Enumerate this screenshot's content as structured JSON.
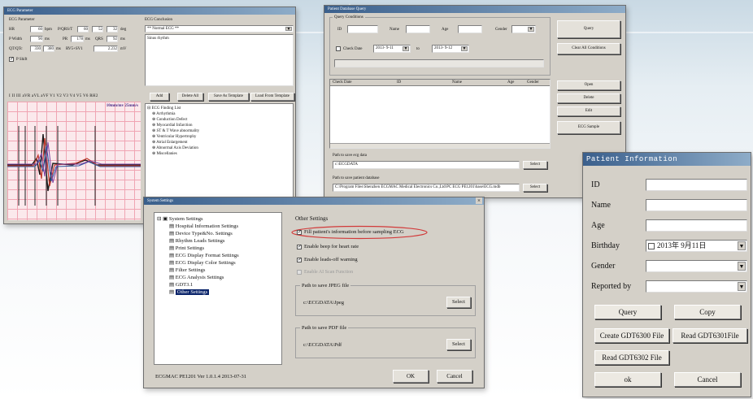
{
  "ecg_params": {
    "title": "ECG Parameter",
    "sections": {
      "parameters": "ECG Parameter",
      "conclusion": "ECG Conclusion"
    },
    "rows": [
      {
        "label": "HR",
        "v1": "60",
        "u1": "bpm",
        "label2": "P/QRS/T",
        "v2": "60",
        "v3": "52",
        "v4": "32",
        "u2": "deg"
      },
      {
        "label": "P Width",
        "v1": "90",
        "u1": "ms",
        "label2": "PR",
        "v2": "178",
        "u2": "ms",
        "label3": "QRS",
        "v3": "92",
        "u3": "ms"
      },
      {
        "label": "QT/QTc",
        "v1": "330",
        "v2": "380",
        "u1": "ms",
        "label2": "RV5+SV1",
        "v3": "2.232",
        "u2": "mV"
      }
    ],
    "pshift": "P Shift",
    "leads": "I  II  III  aVR  aVL  aVF  V1  V2  V3  V4  V5  V6  RH2",
    "speed": "10mm/mv  25mm/s",
    "conclusion_combo": "** Normal ECG **",
    "conclusion_text": "Sinus rhythm",
    "buttons": [
      "Add",
      "Delete All",
      "Save As Template",
      "Load From Template"
    ],
    "finding_root": "ECG Finding List",
    "findings": [
      "Arrhythmia",
      "Conduction Defect",
      "Myocardial Infarction",
      "ST & T Wave abnormality",
      "Ventricular Hypertrophy",
      "Atrial Enlargement",
      "Abnormal Axis Deviation",
      "Miscellanies"
    ]
  },
  "patient_db": {
    "title": "Patient Database Query",
    "group": "Query Conditions",
    "labels": {
      "id": "ID",
      "name": "Name",
      "age": "Age",
      "gender": "Gender",
      "check_date": "Check Date",
      "to": "to"
    },
    "date_from": "2013- 9-11",
    "date_to": "2013- 9-12",
    "columns": [
      "Check Date",
      "ID",
      "Name",
      "Age",
      "Gender"
    ],
    "path1_label": "Path to save ecg data",
    "path1_value": "c:\\ECGDATA",
    "path2_label": "Path to save patient database",
    "path2_value": "C:\\Program Files\\Shenzhen ECGMAC Medical Electronics Co.,Ltd\\PC ECG PE1201\\base\\ECG.mdb",
    "select": "Select",
    "right_buttons": [
      "Query",
      "Clear All Conditions",
      "Open",
      "Delete",
      "Edit",
      "ECG Sample"
    ]
  },
  "system_settings": {
    "title": "System Settings",
    "close": "×",
    "tree_root": "System Settings",
    "tree_items": [
      "Hospital Information Settings",
      "Device Type&No. Settings",
      "Rhythm Leads Settings",
      "Print Settings",
      "ECG Display Format Settings",
      "ECG Display Color Settings",
      "Filter Settings",
      "ECG Analysis Settings",
      "GDT3.1",
      "Other Settings"
    ],
    "other_settings": "Other Settings",
    "options": [
      {
        "label": "Fill patient's information before sampling ECG",
        "checked": true
      },
      {
        "label": "Enable beep for heart rate",
        "checked": true
      },
      {
        "label": "Enable leads-off warning",
        "checked": true
      },
      {
        "label": "Enable AI Scan Function",
        "checked": false
      }
    ],
    "jpeg_label": "Path to save JPEG file",
    "jpeg_value": "c:\\ECGDATA\\Jpeg",
    "pdf_label": "Path to save PDF file",
    "pdf_value": "c:\\ECGDATA\\Pdf",
    "select": "Select",
    "version": "ECGMAC PE1201 Ver 1.0.1.4 2013-07-31",
    "ok": "OK",
    "cancel": "Cancel"
  },
  "patient_info": {
    "title": "Patient Information",
    "labels": {
      "id": "ID",
      "name": "Name",
      "age": "Age",
      "birthday": "Birthday",
      "gender": "Gender",
      "reported_by": "Reported by"
    },
    "birthday_value": "2013年  9月11日",
    "buttons": {
      "query": "Query",
      "copy": "Copy",
      "create": "Create GDT6300 File",
      "read6301": "Read GDT6301File",
      "read6302": "Read GDT6302 File",
      "ok": "ok",
      "cancel": "Cancel"
    }
  },
  "colors": {
    "accent": "#0a246a",
    "titlebar": "#3a5f8c",
    "highlight_ellipse": "#d23a3a",
    "ecg_grid": "#f0a5b3"
  }
}
